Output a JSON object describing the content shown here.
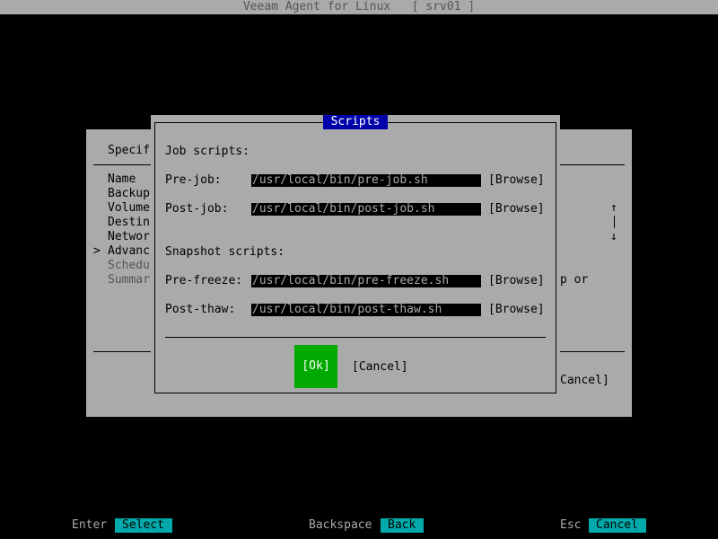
{
  "window": {
    "title": "Veeam Agent for Linux   [ srv01 ]"
  },
  "wizard": {
    "heading": "Specif",
    "steps": [
      {
        "marker": " ",
        "label": "Name"
      },
      {
        "marker": " ",
        "label": "Backup"
      },
      {
        "marker": " ",
        "label": "Volume"
      },
      {
        "marker": " ",
        "label": "Destin"
      },
      {
        "marker": " ",
        "label": "Networ"
      },
      {
        "marker": ">",
        "label": "Advanc"
      },
      {
        "marker": " ",
        "label": "Schedu"
      },
      {
        "marker": " ",
        "label": "Summar"
      }
    ],
    "scroll_up": "↑",
    "scroll_down": "↓",
    "partial_text": "p or",
    "cancel_partial": "Cancel]"
  },
  "dialog": {
    "title": "Scripts",
    "job_section": "Job scripts:",
    "snapshot_section": "Snapshot scripts:",
    "rows": {
      "pre_job": {
        "label": "Pre-job:",
        "value": "/usr/local/bin/pre-job.sh",
        "browse": "[Browse]"
      },
      "post_job": {
        "label": "Post-job:",
        "value": "/usr/local/bin/post-job.sh",
        "browse": "[Browse]"
      },
      "pre_freeze": {
        "label": "Pre-freeze:",
        "value": "/usr/local/bin/pre-freeze.sh",
        "browse": "[Browse]"
      },
      "post_thaw": {
        "label": "Post-thaw:",
        "value": "/usr/local/bin/post-thaw.sh",
        "browse": "[Browse]"
      }
    },
    "ok_label": "[Ok]",
    "cancel_label": "[Cancel]"
  },
  "footer": {
    "enter": {
      "key": "Enter",
      "action": "Select"
    },
    "backspace": {
      "key": "Backspace",
      "action": "Back"
    },
    "esc": {
      "key": "Esc",
      "action": "Cancel"
    }
  },
  "colors": {
    "background": "#000000",
    "panel": "#aaaaaa",
    "title_highlight": "#0000aa",
    "ok_button": "#00aa00",
    "footer_action": "#00aaaa"
  }
}
